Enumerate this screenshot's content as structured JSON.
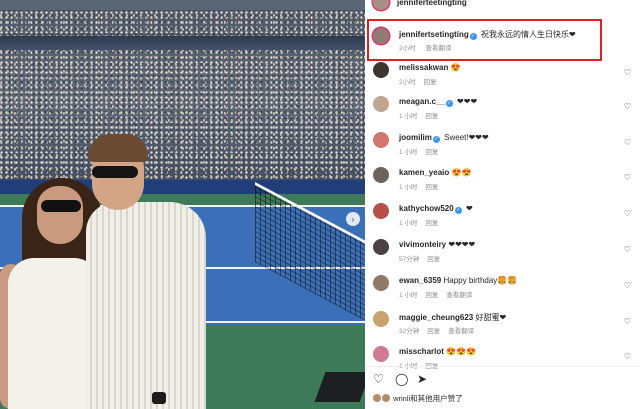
{
  "post_owner": {
    "username": "jenniferteetingting",
    "avatar_color": "#a68f86"
  },
  "highlighted_comment": {
    "username": "jennifertsetingting",
    "verified": true,
    "text": "祝我永远的情人生日快乐❤",
    "time": "2小时",
    "translate": "查看翻译",
    "avatar_color": "#8e7c72",
    "highlight_color": "#e02020"
  },
  "comments": [
    {
      "username": "melissakwan",
      "verified": false,
      "text": "😍",
      "time": "2小时",
      "reply": "回复",
      "extra": "",
      "avatar_color": "#3d3530"
    },
    {
      "username": "meagan.c__",
      "verified": true,
      "text": "❤❤❤",
      "time": "1 小时",
      "reply": "回复",
      "extra": "",
      "avatar_color": "#c1a38f"
    },
    {
      "username": "joomilim",
      "verified": true,
      "text": "Sweet!❤❤❤",
      "time": "1 小时",
      "reply": "回复",
      "extra": "",
      "avatar_color": "#d4746e"
    },
    {
      "username": "kamen_yeaio",
      "verified": false,
      "text": "😍😍",
      "time": "1 小时",
      "reply": "回复",
      "extra": "",
      "avatar_color": "#6e625c"
    },
    {
      "username": "kathychow520",
      "verified": true,
      "text": "❤",
      "time": "1 小时",
      "reply": "回复",
      "extra": "",
      "avatar_color": "#b84f4a"
    },
    {
      "username": "vivimonteiry",
      "verified": false,
      "text": "❤❤❤❤",
      "time": "57分钟",
      "reply": "回复",
      "extra": "",
      "avatar_color": "#4a4140"
    },
    {
      "username": "ewan_6359",
      "verified": false,
      "text": "Happy birthday🍔🍔",
      "time": "1 小时",
      "reply": "回复",
      "extra": "查看翻译",
      "avatar_color": "#8f7a69"
    },
    {
      "username": "maggie_cheung623",
      "verified": false,
      "text": "好甜蜜❤",
      "time": "32分钟",
      "reply": "回复",
      "extra": "查看翻译",
      "avatar_color": "#c9a270"
    },
    {
      "username": "misscharlot",
      "verified": false,
      "text": "😍😍😍",
      "time": "1 小时",
      "reply": "回复",
      "extra": "",
      "avatar_color": "#d07a92"
    }
  ],
  "actions": {
    "like_icon": "♡",
    "comment_icon": "◯",
    "share_icon": "➤"
  },
  "likes_line": "wrinli和其他用户赞了"
}
